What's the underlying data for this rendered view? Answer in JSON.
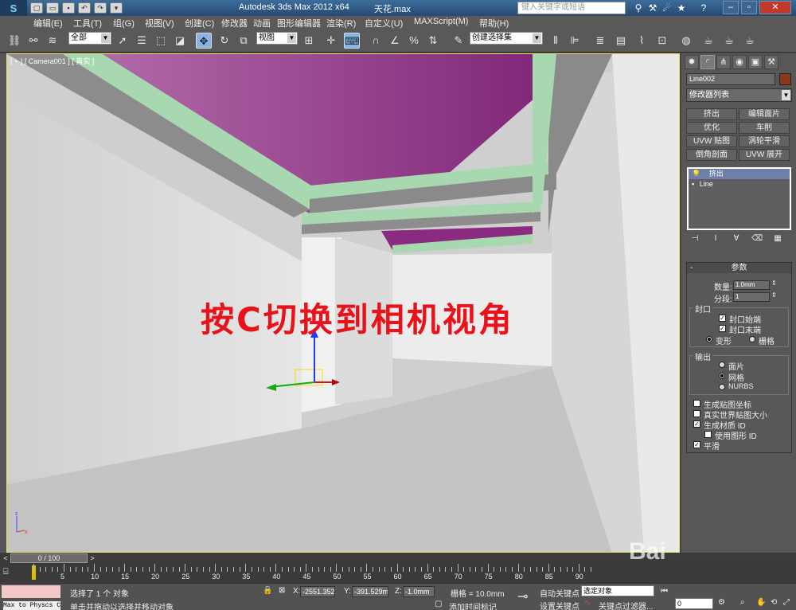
{
  "titlebar": {
    "app_title": "Autodesk 3ds Max  2012 x64",
    "file_name": "天花.max",
    "search_placeholder": "键入关键字或短语",
    "logo": "3ds-max-logo",
    "quick_access": [
      "new",
      "open",
      "save",
      "undo",
      "redo"
    ]
  },
  "menu": [
    "编辑(E)",
    "工具(T)",
    "组(G)",
    "视图(V)",
    "创建(C)",
    "修改器",
    "动画",
    "图形编辑器",
    "渲染(R)",
    "自定义(U)",
    "MAXScript(M)",
    "帮助(H)"
  ],
  "toolbar": {
    "selection_filter": "全部",
    "ref_coord": "视图",
    "named_selection": "创建选择集"
  },
  "viewport": {
    "label": "[ + ] [ Camera001 ] [ 真实 ]",
    "overlay_text": "按C切换到相机视角",
    "ceiling_color": "#8a2a80",
    "trim_color": "#a8d8b0",
    "wall_color": "#e2e2e2",
    "floor_color": "#c4c4c4",
    "gizmo_axes": [
      "x",
      "y",
      "z"
    ]
  },
  "watermark": "Bai",
  "command_panel": {
    "tabs": [
      "create",
      "modify",
      "hierarchy",
      "motion",
      "display",
      "utilities"
    ],
    "object_name": "Line002",
    "modifier_list": "修改器列表",
    "mod_buttons": [
      "挤出",
      "编辑面片",
      "优化",
      "车削",
      "UVW 贴图",
      "涡轮平滑",
      "倒角剖面",
      "UVW 展开"
    ],
    "stack": [
      "挤出",
      "Line"
    ],
    "params": {
      "title": "参数",
      "amount_label": "数量:",
      "amount_value": "1.0mm",
      "segments_label": "分段:",
      "segments_value": "1",
      "capping_title": "封口",
      "cap_start": "封口始端",
      "cap_end": "封口末端",
      "morph": "变形",
      "grid": "栅格",
      "output_title": "输出",
      "patch": "面片",
      "mesh": "网格",
      "nurbs": "NURBS",
      "gen_map": "生成贴图坐标",
      "real_world": "真实世界贴图大小",
      "gen_mat": "生成材质 ID",
      "use_shape": "使用图形 ID",
      "smooth": "平滑"
    }
  },
  "timeline": {
    "frame_display": "0 / 100",
    "ticks": [
      "0",
      "5",
      "10",
      "15",
      "20",
      "25",
      "30",
      "35",
      "40",
      "45",
      "50",
      "55",
      "60",
      "65",
      "70",
      "75",
      "80",
      "85",
      "90"
    ]
  },
  "status": {
    "listener": "Max to Physcs C",
    "selected": "选择了 1 个 对象",
    "prompt": "单击并拖动以选择并移动对象",
    "x_label": "X:",
    "x": "-2551.352",
    "y_label": "Y:",
    "y": "-391.529m",
    "z_label": "Z:",
    "z": "-1.0mm",
    "grid": "栅格 = 10.0mm",
    "add_time_tag": "添加时间标记",
    "auto_key": "自动关键点",
    "set_key": "设置关键点",
    "selected_dd": "选定对象",
    "key_filters": "关键点过滤器...",
    "frame": "0"
  }
}
